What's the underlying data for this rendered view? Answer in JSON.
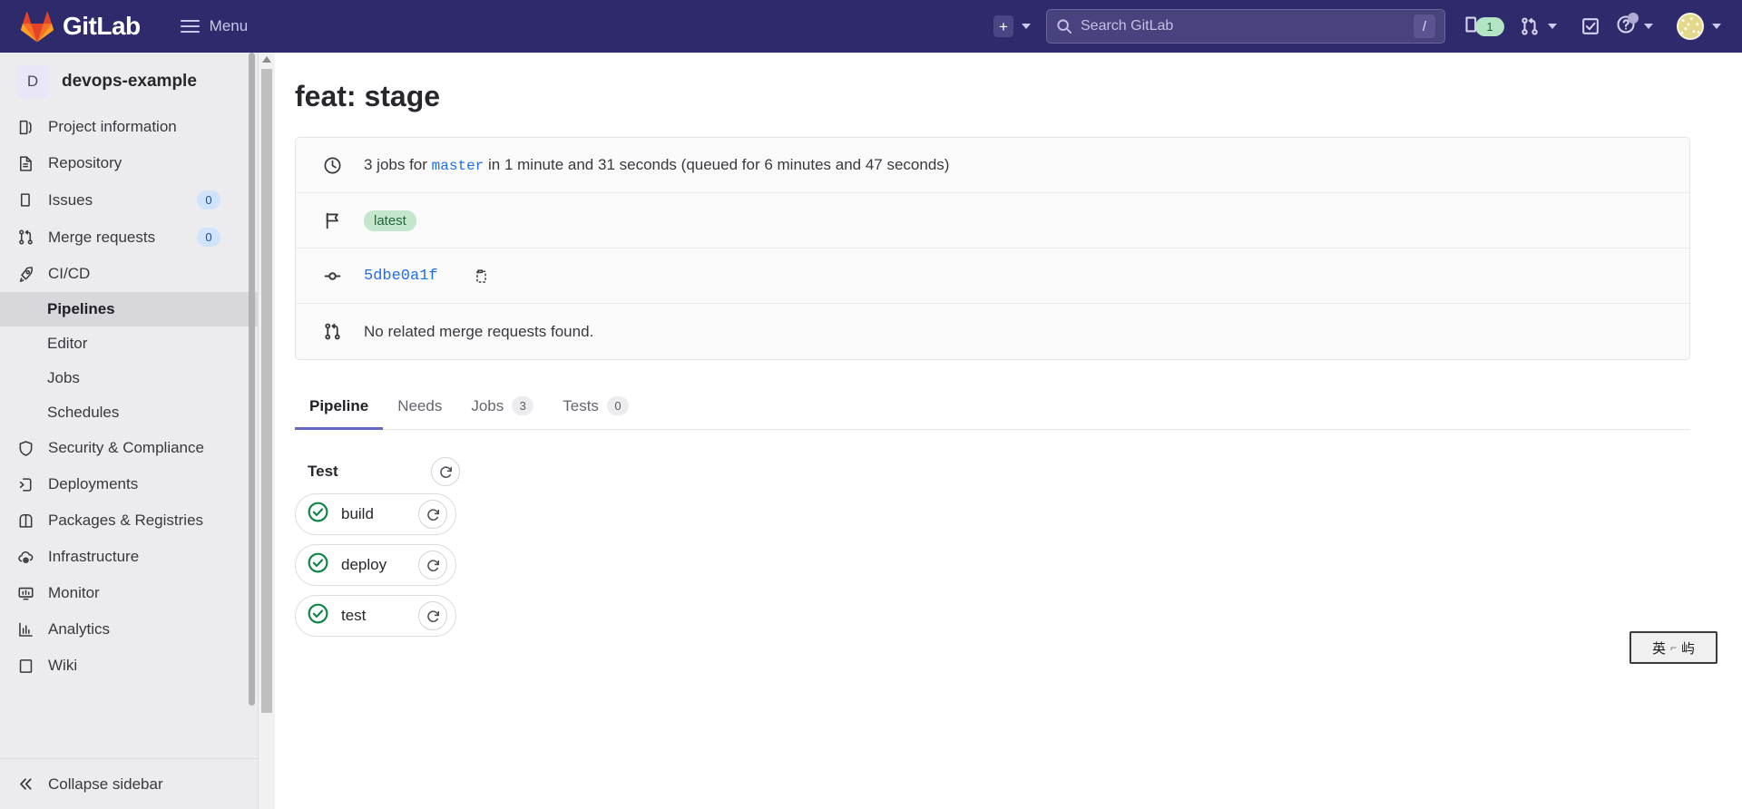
{
  "topnav": {
    "brand": "GitLab",
    "menu_label": "Menu",
    "new_label": "+",
    "search_placeholder": "Search GitLab",
    "search_shortcut": "/",
    "issues_count": "1",
    "icons": {
      "logo": "gitlab-logo",
      "hamburger": "hamburger-icon",
      "new_dropdown": "chevron-down-icon",
      "search": "search-icon",
      "issues": "issues-icon",
      "merge_requests": "merge-request-icon",
      "todos": "todo-checkbox-icon",
      "help": "help-circle-icon",
      "avatar": "user-avatar"
    }
  },
  "sidebar": {
    "project": {
      "initial": "D",
      "name": "devops-example"
    },
    "items": [
      {
        "label": "Project information",
        "icon": "book-icon",
        "count": null
      },
      {
        "label": "Repository",
        "icon": "document-icon",
        "count": null
      },
      {
        "label": "Issues",
        "icon": "issues-icon",
        "count": "0"
      },
      {
        "label": "Merge requests",
        "icon": "merge-request-icon",
        "count": "0"
      },
      {
        "label": "CI/CD",
        "icon": "rocket-icon",
        "count": null
      }
    ],
    "cicd_subitems": [
      {
        "label": "Pipelines",
        "active": true
      },
      {
        "label": "Editor",
        "active": false
      },
      {
        "label": "Jobs",
        "active": false
      },
      {
        "label": "Schedules",
        "active": false
      }
    ],
    "items_after": [
      {
        "label": "Security & Compliance",
        "icon": "shield-icon"
      },
      {
        "label": "Deployments",
        "icon": "deployments-icon"
      },
      {
        "label": "Packages & Registries",
        "icon": "package-icon"
      },
      {
        "label": "Infrastructure",
        "icon": "cloud-gear-icon"
      },
      {
        "label": "Monitor",
        "icon": "monitor-icon"
      },
      {
        "label": "Analytics",
        "icon": "chart-icon"
      },
      {
        "label": "Wiki",
        "icon": "wiki-icon"
      }
    ],
    "collapse_label": "Collapse sidebar",
    "collapse_icon": "double-chevron-left-icon"
  },
  "main": {
    "page_title": "feat: stage",
    "info_rows": {
      "jobs_prefix": "3 jobs for",
      "jobs_ref": "master",
      "jobs_suffix": "in 1 minute and 31 seconds (queued for 6 minutes and 47 seconds)",
      "latest_badge": "latest",
      "commit_sha": "5dbe0a1f",
      "merge_request_text": "No related merge requests found."
    },
    "tabs": [
      {
        "label": "Pipeline",
        "badge": null,
        "active": true
      },
      {
        "label": "Needs",
        "badge": null,
        "active": false
      },
      {
        "label": "Jobs",
        "badge": "3",
        "active": false
      },
      {
        "label": "Tests",
        "badge": "0",
        "active": false
      }
    ],
    "pipeline_graph": {
      "stages": [
        {
          "name": "Test",
          "action_icon": "retry-icon",
          "jobs": [
            {
              "name": "build",
              "status": "success",
              "status_icon": "check-circle-icon",
              "action_icon": "retry-icon"
            },
            {
              "name": "deploy",
              "status": "success",
              "status_icon": "check-circle-icon",
              "action_icon": "retry-icon"
            },
            {
              "name": "test",
              "status": "success",
              "status_icon": "check-circle-icon",
              "action_icon": "retry-icon"
            }
          ]
        }
      ]
    }
  },
  "ime": {
    "lang": "英",
    "sep": "⌐",
    "mode": "屿"
  },
  "colors": {
    "nav_bg": "#2f2a6b",
    "sidebar_bg": "#ececef",
    "accent": "#6666c4",
    "link": "#1f6feb",
    "success": "#108548",
    "badge_green_bg": "#c3e6cd"
  }
}
